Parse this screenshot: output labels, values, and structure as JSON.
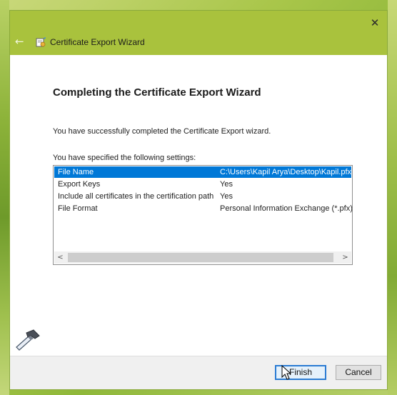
{
  "window": {
    "title": "Certificate Export Wizard",
    "close_glyph": "✕",
    "back_glyph": "←"
  },
  "content": {
    "heading": "Completing the Certificate Export Wizard",
    "message_success": "You have successfully completed the Certificate Export wizard.",
    "message_settings": "You have specified the following settings:"
  },
  "settings": [
    {
      "name": "File Name",
      "value": "C:\\Users\\Kapil Arya\\Desktop\\Kapil.pfx",
      "selected": true
    },
    {
      "name": "Export Keys",
      "value": "Yes",
      "selected": false
    },
    {
      "name": "Include all certificates in the certification path",
      "value": "Yes",
      "selected": false
    },
    {
      "name": "File Format",
      "value": "Personal Information Exchange (*.pfx)",
      "selected": false
    }
  ],
  "scrollbar": {
    "left_glyph": "<",
    "right_glyph": ">"
  },
  "buttons": {
    "finish": "Finish",
    "cancel": "Cancel"
  },
  "colors": {
    "titlebar": "#a9c23d",
    "selection": "#0078d7",
    "default_button_border": "#2a7bd3"
  }
}
